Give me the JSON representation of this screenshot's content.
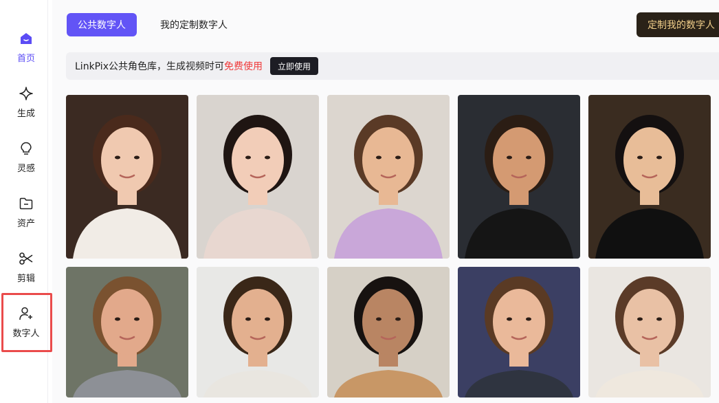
{
  "sidebar": {
    "items": [
      {
        "label": "首页",
        "icon": "home-icon",
        "active": true
      },
      {
        "label": "生成",
        "icon": "sparkle-icon",
        "active": false
      },
      {
        "label": "灵感",
        "icon": "lightbulb-icon",
        "active": false
      },
      {
        "label": "资产",
        "icon": "folder-icon",
        "active": false
      },
      {
        "label": "剪辑",
        "icon": "scissors-icon",
        "active": false
      },
      {
        "label": "数字人",
        "icon": "user-add-icon",
        "active": false
      }
    ]
  },
  "tabs": [
    {
      "label": "公共数字人",
      "active": true
    },
    {
      "label": "我的定制数字人",
      "active": false
    }
  ],
  "cta_label": "定制我的数字人",
  "banner": {
    "text": "LinkPix公共角色库，生成视频时可",
    "free_text": "免费使用",
    "button_label": "立即使用"
  },
  "avatars": [
    {
      "bg": "#3b2a22",
      "skin": "#f0c9b0",
      "hair": "#4a2a1c",
      "shirt": "#f1ece6"
    },
    {
      "bg": "#d9d4cf",
      "skin": "#f2cdb8",
      "hair": "#1f1512",
      "shirt": "#e8d7d0"
    },
    {
      "bg": "#dcd6cf",
      "skin": "#e8b894",
      "hair": "#5a3a26",
      "shirt": "#c9a7d9"
    },
    {
      "bg": "#2a2d33",
      "skin": "#d49a72",
      "hair": "#2b1d14",
      "shirt": "#151515"
    },
    {
      "bg": "#3a2c20",
      "skin": "#e8bd98",
      "hair": "#141010",
      "shirt": "#101010"
    },
    {
      "bg": "#6e7466",
      "skin": "#e2a98b",
      "hair": "#7a5230",
      "shirt": "#8d9096"
    },
    {
      "bg": "#e8e8e6",
      "skin": "#e3b08f",
      "hair": "#3a2718",
      "shirt": "#e9e6e0"
    },
    {
      "bg": "#d6d0c6",
      "skin": "#b98563",
      "hair": "#171210",
      "shirt": "#c89766"
    },
    {
      "bg": "#3b3f63",
      "skin": "#eab99a",
      "hair": "#5a3a24",
      "shirt": "#2f3440"
    },
    {
      "bg": "#eae6e1",
      "skin": "#e9c1a5",
      "hair": "#5b3b28",
      "shirt": "#efe8de"
    }
  ]
}
